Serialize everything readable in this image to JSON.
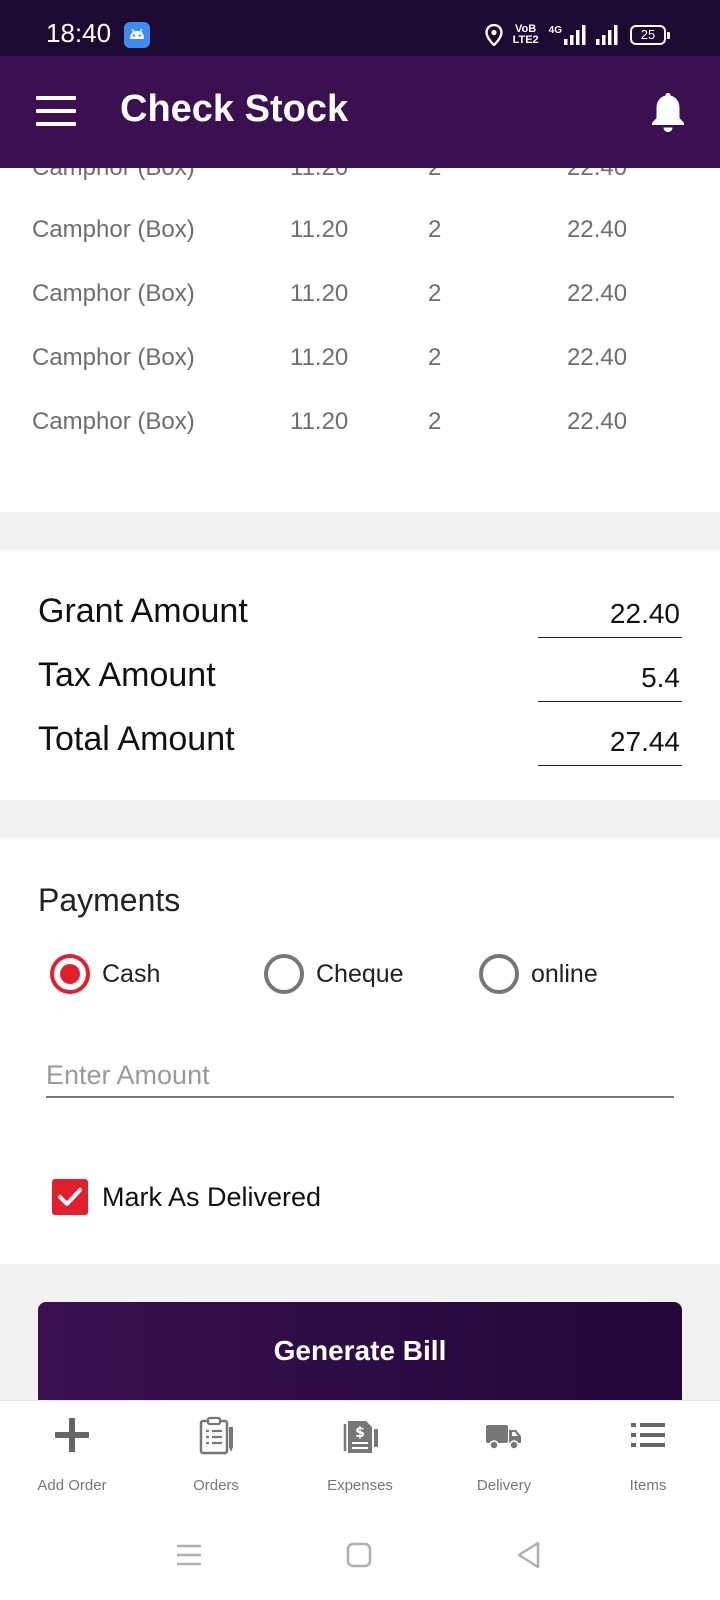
{
  "status_bar": {
    "time": "18:40",
    "network_label_1": "VoB",
    "network_label_2": "LTE2",
    "signal_label": "4G",
    "battery_level": "25"
  },
  "app_bar": {
    "title": "Check Stock"
  },
  "items_table": {
    "rows": [
      {
        "name": "Camphor (Box)",
        "price": "11.20",
        "qty": "2",
        "total": "22.40"
      },
      {
        "name": "Camphor (Box)",
        "price": "11.20",
        "qty": "2",
        "total": "22.40"
      },
      {
        "name": "Camphor (Box)",
        "price": "11.20",
        "qty": "2",
        "total": "22.40"
      },
      {
        "name": "Camphor (Box)",
        "price": "11.20",
        "qty": "2",
        "total": "22.40"
      },
      {
        "name": "Camphor (Box)",
        "price": "11.20",
        "qty": "2",
        "total": "22.40"
      }
    ]
  },
  "amounts": {
    "grant_label": "Grant Amount",
    "grant_value": "22.40",
    "tax_label": "Tax Amount",
    "tax_value": "5.4",
    "total_label": "Total Amount",
    "total_value": "27.44"
  },
  "payments": {
    "title": "Payments",
    "options": [
      {
        "label": "Cash",
        "selected": true
      },
      {
        "label": "Cheque",
        "selected": false
      },
      {
        "label": "online",
        "selected": false
      }
    ],
    "amount_placeholder": "Enter Amount",
    "amount_value": "",
    "mark_delivered_label": "Mark As Delivered",
    "mark_delivered_checked": true
  },
  "generate_bill_label": "Generate Bill",
  "bottom_nav": {
    "items": [
      {
        "label": "Add Order",
        "icon": "plus-icon"
      },
      {
        "label": "Orders",
        "icon": "clipboard-icon"
      },
      {
        "label": "Expenses",
        "icon": "expense-receipt-icon"
      },
      {
        "label": "Delivery",
        "icon": "truck-icon"
      },
      {
        "label": "Items",
        "icon": "list-icon"
      }
    ]
  },
  "colors": {
    "status_bar": "#1c0a33",
    "app_bar": "#3a1050",
    "accent_red": "#e0202e",
    "button_start": "#3a1050",
    "button_end": "#22073a"
  }
}
